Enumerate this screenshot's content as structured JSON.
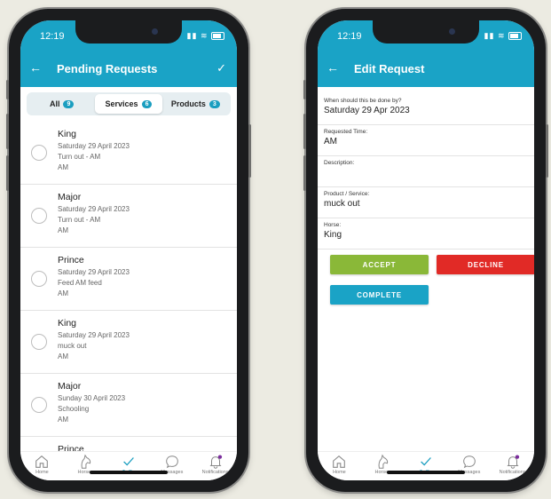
{
  "left": {
    "status_time": "12:19",
    "title": "Pending Requests",
    "tabs": [
      {
        "label": "All",
        "count": "9"
      },
      {
        "label": "Services",
        "count": "6"
      },
      {
        "label": "Products",
        "count": "3"
      }
    ],
    "items": [
      {
        "horse": "King",
        "date": "Saturday 29 April 2023",
        "task": "Turn out - AM",
        "time": "AM"
      },
      {
        "horse": "Major",
        "date": "Saturday 29 April 2023",
        "task": "Turn out - AM",
        "time": "AM"
      },
      {
        "horse": "Prince",
        "date": "Saturday 29 April 2023",
        "task": "Feed AM feed",
        "time": "AM"
      },
      {
        "horse": "King",
        "date": "Saturday 29 April 2023",
        "task": "muck out",
        "time": "AM"
      },
      {
        "horse": "Major",
        "date": "Sunday 30 April 2023",
        "task": "Schooling",
        "time": "AM"
      },
      {
        "horse": "Prince",
        "date": "",
        "task": "",
        "time": ""
      }
    ]
  },
  "right": {
    "status_time": "12:19",
    "title": "Edit Request",
    "fields": [
      {
        "label": "When should this be done by?",
        "value": "Saturday 29 Apr 2023"
      },
      {
        "label": "Requested Time:",
        "value": "AM"
      },
      {
        "label": "Description:",
        "value": ""
      },
      {
        "label": "Product / Service:",
        "value": "muck out"
      },
      {
        "label": "Horse:",
        "value": "King"
      }
    ],
    "accept_label": "ACCEPT",
    "decline_label": "DECLINE",
    "complete_label": "COMPLETE"
  },
  "nav": {
    "home": "Home",
    "horses": "Horses",
    "todo": "To Do",
    "messages": "Messages",
    "notifications": "Notifications"
  },
  "colors": {
    "accent": "#1aa3c6",
    "accept": "#8ab838",
    "decline": "#e12a26",
    "notification_dot": "#7b2d9c"
  }
}
